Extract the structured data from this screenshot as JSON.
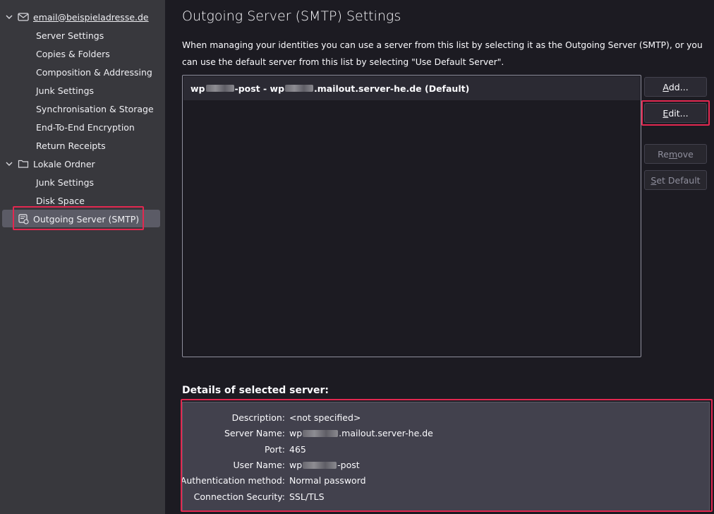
{
  "sidebar": {
    "account": {
      "label": "email@beispieladresse.de"
    },
    "account_items": [
      "Server Settings",
      "Copies & Folders",
      "Composition & Addressing",
      "Junk Settings",
      "Synchronisation & Storage",
      "End-To-End Encryption",
      "Return Receipts"
    ],
    "local": {
      "label": "Lokale Ordner"
    },
    "local_items": [
      "Junk Settings",
      "Disk Space"
    ],
    "smtp": {
      "label": "Outgoing Server (SMTP)"
    }
  },
  "main": {
    "title": "Outgoing Server (SMTP) Settings",
    "intro": "When managing your identities you can use a server from this list by selecting it as the Outgoing Server (SMTP), or you can use the default server from this list by selecting \"Use Default Server\".",
    "server_item": {
      "part1": "wp",
      "part2": "-post - wp",
      "part3": ".mailout.server-he.de (Default)"
    },
    "buttons": {
      "add": {
        "pre": "",
        "u": "A",
        "post": "dd..."
      },
      "edit": {
        "pre": "",
        "u": "E",
        "post": "dit..."
      },
      "remove": {
        "pre": "Re",
        "u": "m",
        "post": "ove"
      },
      "set_default": {
        "pre": "",
        "u": "S",
        "post": "et Default"
      }
    },
    "details_title": "Details of selected server:",
    "details": {
      "description_label": "Description:",
      "description_value": "<not specified>",
      "server_label": "Server Name:",
      "server_value_pre": "wp",
      "server_value_post": ".mailout.server-he.de",
      "port_label": "Port:",
      "port_value": "465",
      "user_label": "User Name:",
      "user_value_pre": "wp",
      "user_value_post": "-post",
      "auth_label": "Authentication method:",
      "auth_value": "Normal password",
      "security_label": "Connection Security:",
      "security_value": "SSL/TLS"
    }
  },
  "colors": {
    "highlight": "#e22850",
    "sidebar_bg": "#38383d",
    "main_bg": "#1c1b22"
  }
}
